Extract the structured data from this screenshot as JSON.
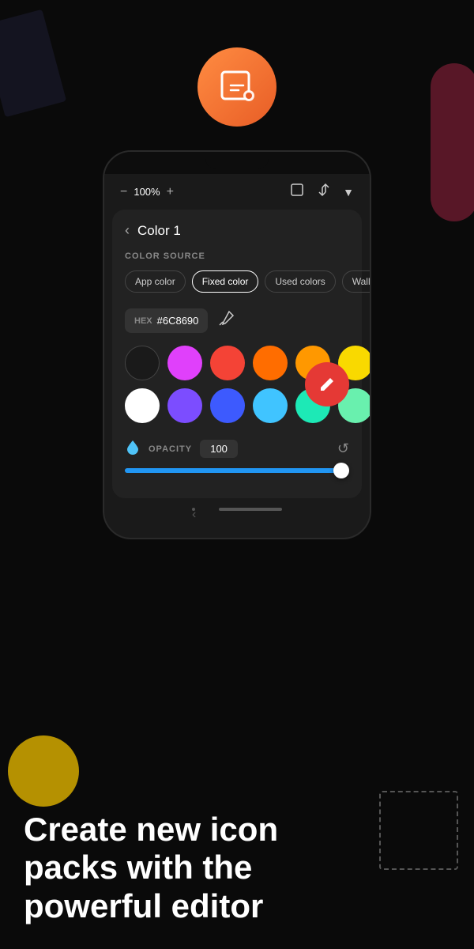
{
  "app": {
    "background_color": "#0a0a0a",
    "icon_gradient_start": "#ff8c42",
    "icon_gradient_end": "#e85d26"
  },
  "toolbar": {
    "zoom_label": "100%",
    "zoom_minus": "−",
    "zoom_plus": "+"
  },
  "color_panel": {
    "title": "Color 1",
    "section_label": "COLOR SOURCE",
    "tabs": [
      {
        "label": "App color",
        "active": false
      },
      {
        "label": "Fixed color",
        "active": true
      },
      {
        "label": "Used colors",
        "active": false
      },
      {
        "label": "Wallpaper",
        "active": false
      }
    ],
    "hex_label": "HEX",
    "hex_value": "#6C8690",
    "opacity_label": "OPACITY",
    "opacity_value": "100"
  },
  "swatches": {
    "row1": [
      "black",
      "pink",
      "red",
      "orange",
      "amber",
      "yellow"
    ],
    "row2": [
      "white",
      "purple",
      "blue",
      "lightblue",
      "teal",
      "green"
    ]
  },
  "bottom_text": {
    "line1": "Create new icon",
    "line2": "packs with the",
    "line3": "powerful editor"
  }
}
